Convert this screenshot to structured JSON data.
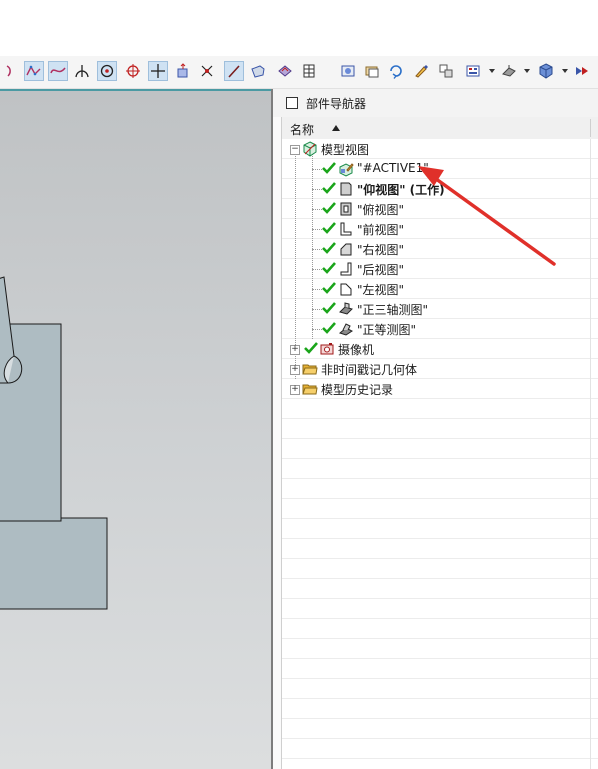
{
  "toolbar": {
    "left_icons": [
      "spline-icon",
      "studio-spline-icon",
      "general-curve-icon",
      "point-on-curve-icon",
      "point-icon",
      "circle-point-icon",
      "crosshair-icon",
      "move-point-icon",
      "snap-point-icon",
      "line-icon",
      "surface-icon",
      "view-section-icon",
      "table-icon"
    ],
    "right_icons": [
      "render-icon",
      "layer-icon",
      "rotate-icon",
      "pencil-icon",
      "replace-view-icon",
      "display-grid-icon",
      "rendering-style-icon",
      "cube-view-icon",
      "more-icon"
    ]
  },
  "navigator": {
    "title": "部件导航器",
    "column_header": "名称",
    "tree": [
      {
        "label": "模型视图",
        "icon": "model-views-icon",
        "expanded": true,
        "children": [
          {
            "label": "\"#ACTIVE1\"",
            "icon": "active-view-icon",
            "checked": true
          },
          {
            "label": "\"仰视图\" (工作)",
            "icon": "bottom-view-icon",
            "checked": true,
            "bold": true
          },
          {
            "label": "\"俯视图\"",
            "icon": "top-view-icon",
            "checked": true
          },
          {
            "label": "\"前视图\"",
            "icon": "front-view-icon",
            "checked": true
          },
          {
            "label": "\"右视图\"",
            "icon": "right-view-icon",
            "checked": true
          },
          {
            "label": "\"后视图\"",
            "icon": "back-view-icon",
            "checked": true
          },
          {
            "label": "\"左视图\"",
            "icon": "left-view-icon",
            "checked": true
          },
          {
            "label": "\"正三轴测图\"",
            "icon": "trimetric-view-icon",
            "checked": true
          },
          {
            "label": "\"正等测图\"",
            "icon": "isometric-view-icon",
            "checked": true
          }
        ]
      },
      {
        "label": "摄像机",
        "icon": "camera-icon",
        "checked": true,
        "expanded": false
      },
      {
        "label": "非时间戳记几何体",
        "icon": "folder-icon",
        "expanded": false
      },
      {
        "label": "模型历史记录",
        "icon": "folder-icon",
        "expanded": false
      }
    ]
  },
  "colors": {
    "check": "#1aa51a",
    "arrow": "#e0302a",
    "folder": "#e8b234",
    "viewport_top": "#bfc2c4",
    "model_fill": "#aebcc2",
    "highlight": "#cfe2f3"
  }
}
